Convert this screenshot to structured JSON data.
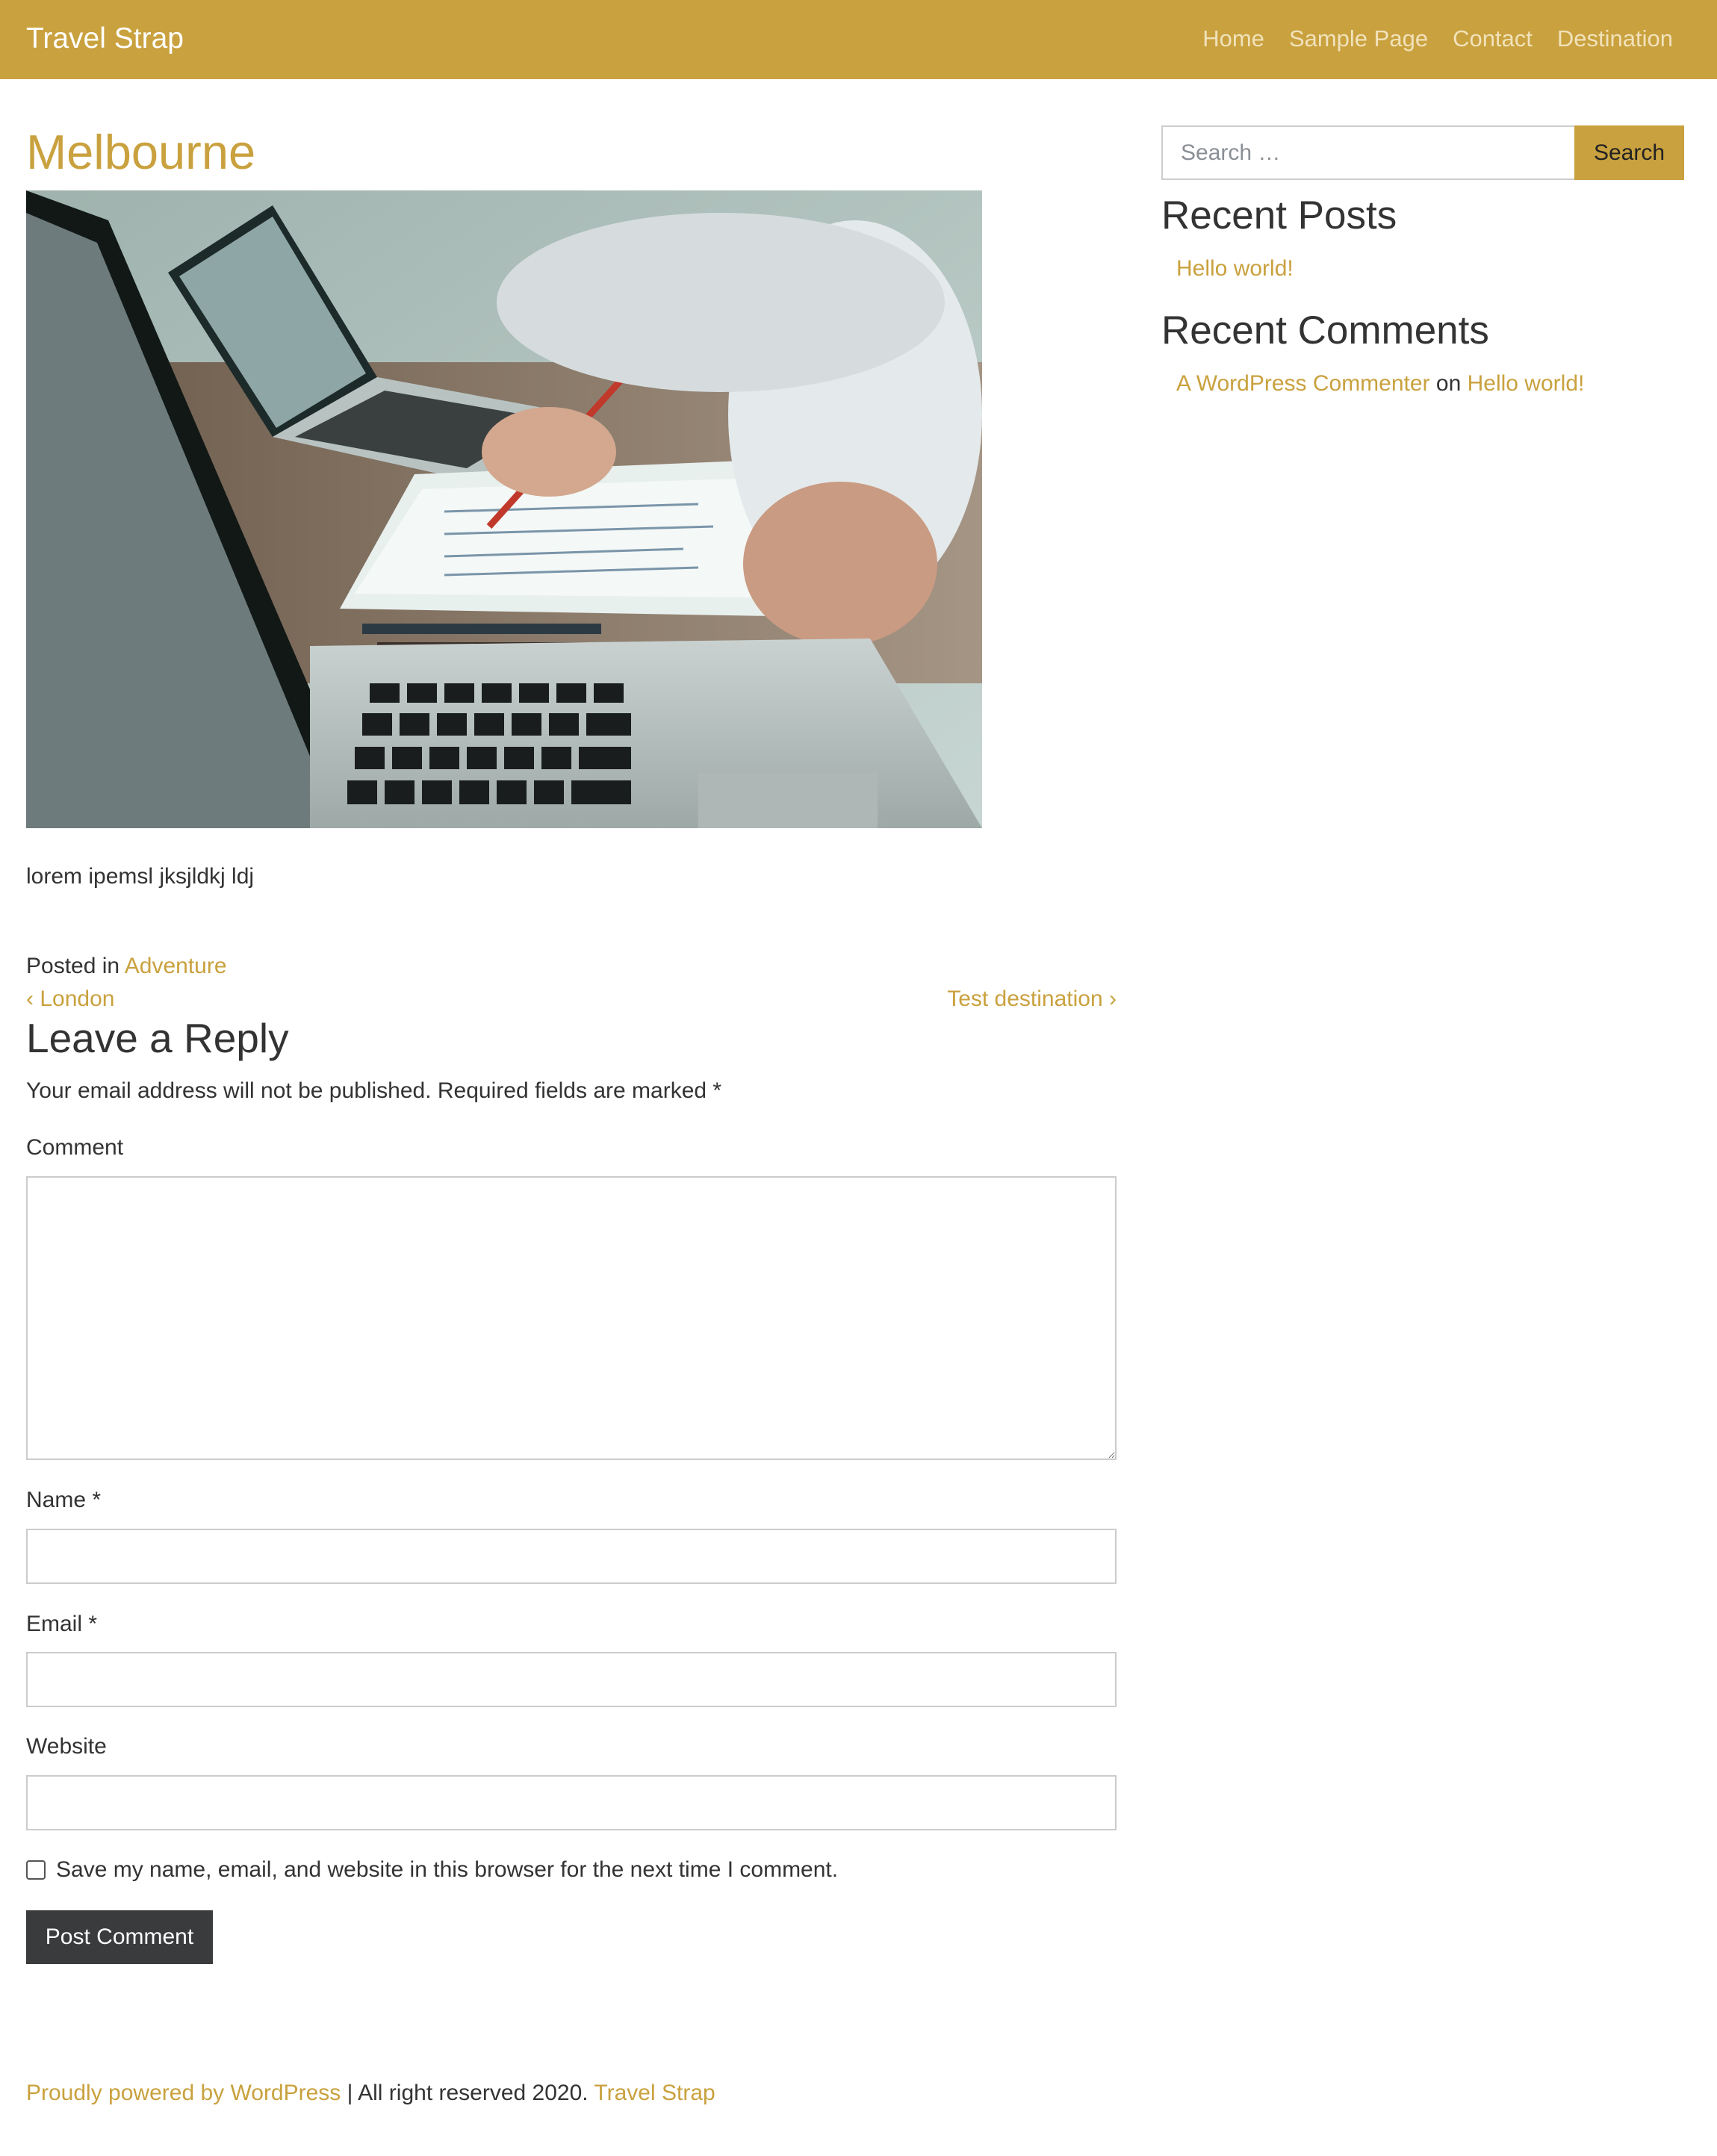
{
  "header": {
    "site_title": "Travel Strap",
    "nav": [
      "Home",
      "Sample Page",
      "Contact",
      "Destination"
    ]
  },
  "post": {
    "title": "Melbourne",
    "content": "lorem ipemsl jksjldkj ldj",
    "posted_in_prefix": "Posted in ",
    "category": "Adventure",
    "prev_post": "London",
    "next_post": "Test destination",
    "prev_icon": "chevron-left-icon",
    "next_icon": "chevron-right-icon"
  },
  "reply_form": {
    "title": "Leave a Reply",
    "notes": "Your email address will not be published. Required fields are marked *",
    "comment_label": "Comment",
    "name_label": "Name *",
    "email_label": "Email *",
    "website_label": "Website",
    "comment_value": "",
    "name_value": "",
    "email_value": "",
    "website_value": "",
    "cookies_label": "Save my name, email, and website in this browser for the next time I comment.",
    "cookies_checked": false,
    "submit_label": "Post Comment"
  },
  "sidebar": {
    "search_placeholder": "Search …",
    "search_button": "Search",
    "recent_posts_title": "Recent Posts",
    "recent_posts": [
      "Hello world!"
    ],
    "recent_comments_title": "Recent Comments",
    "recent_comment": {
      "author": "A WordPress Commenter",
      "joiner": " on ",
      "post": "Hello world!"
    }
  },
  "footer": {
    "powered_by": "Proudly powered by WordPress",
    "separator_text": " | All right reserved 2020. ",
    "site_link": "Travel Strap"
  },
  "colors": {
    "accent": "#c9a13e",
    "nav_text": "#f1e2bb",
    "text": "#333333",
    "button_dark": "#3a3b3d"
  }
}
